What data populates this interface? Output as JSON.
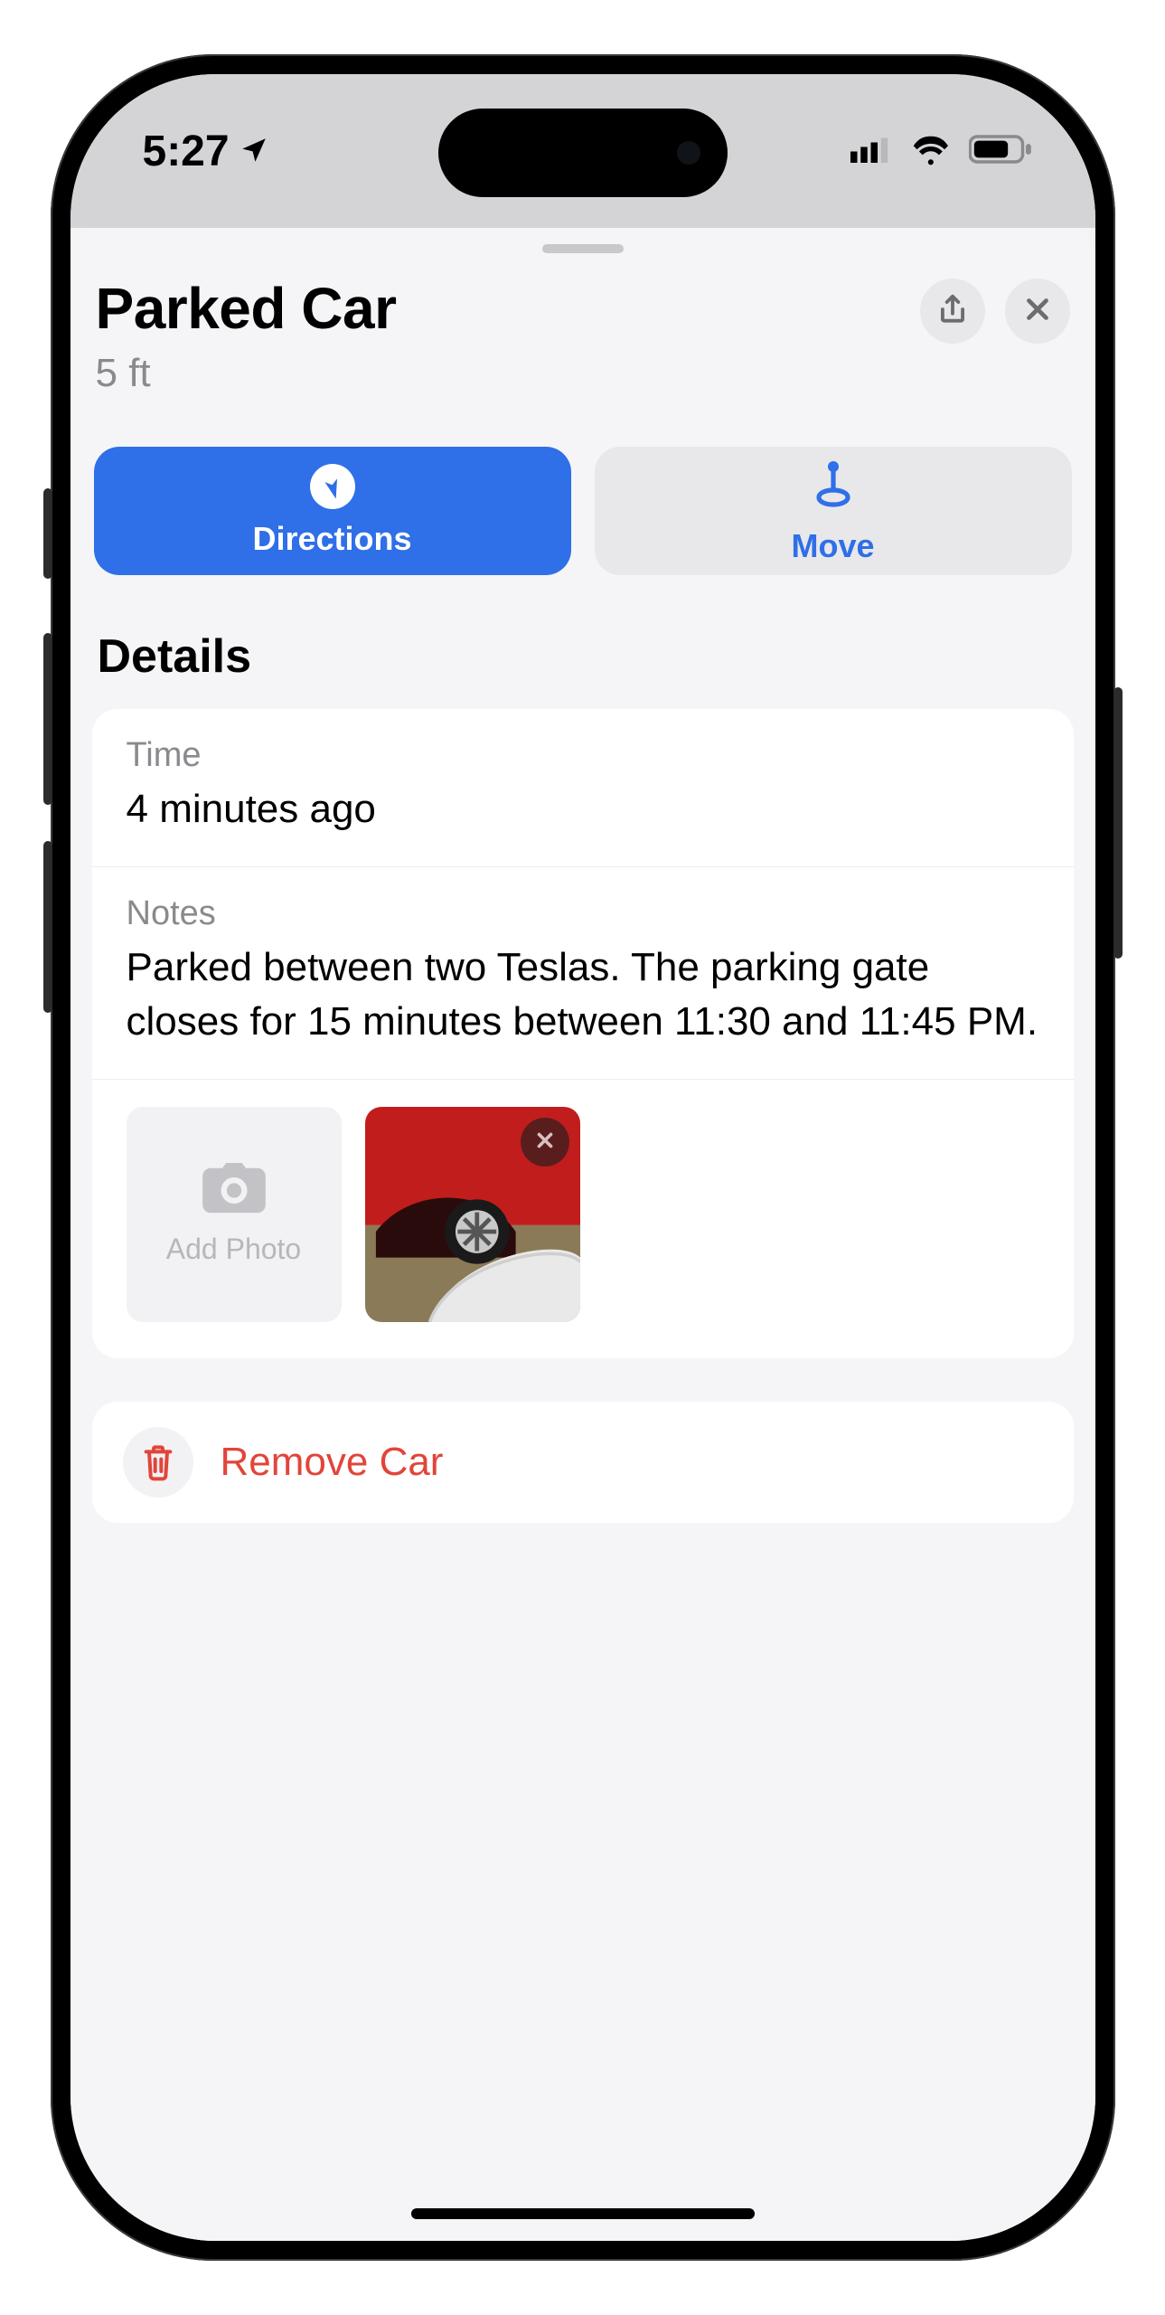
{
  "status": {
    "time": "5:27"
  },
  "header": {
    "title": "Parked Car",
    "distance": "5 ft"
  },
  "actions": {
    "directions_label": "Directions",
    "move_label": "Move"
  },
  "details": {
    "heading": "Details",
    "time_label": "Time",
    "time_value": "4 minutes ago",
    "notes_label": "Notes",
    "notes_value": "Parked between two Teslas. The parking gate closes for 15 minutes between 11:30 and 11:45 PM.",
    "add_photo_label": "Add Photo"
  },
  "remove": {
    "label": "Remove Car"
  }
}
